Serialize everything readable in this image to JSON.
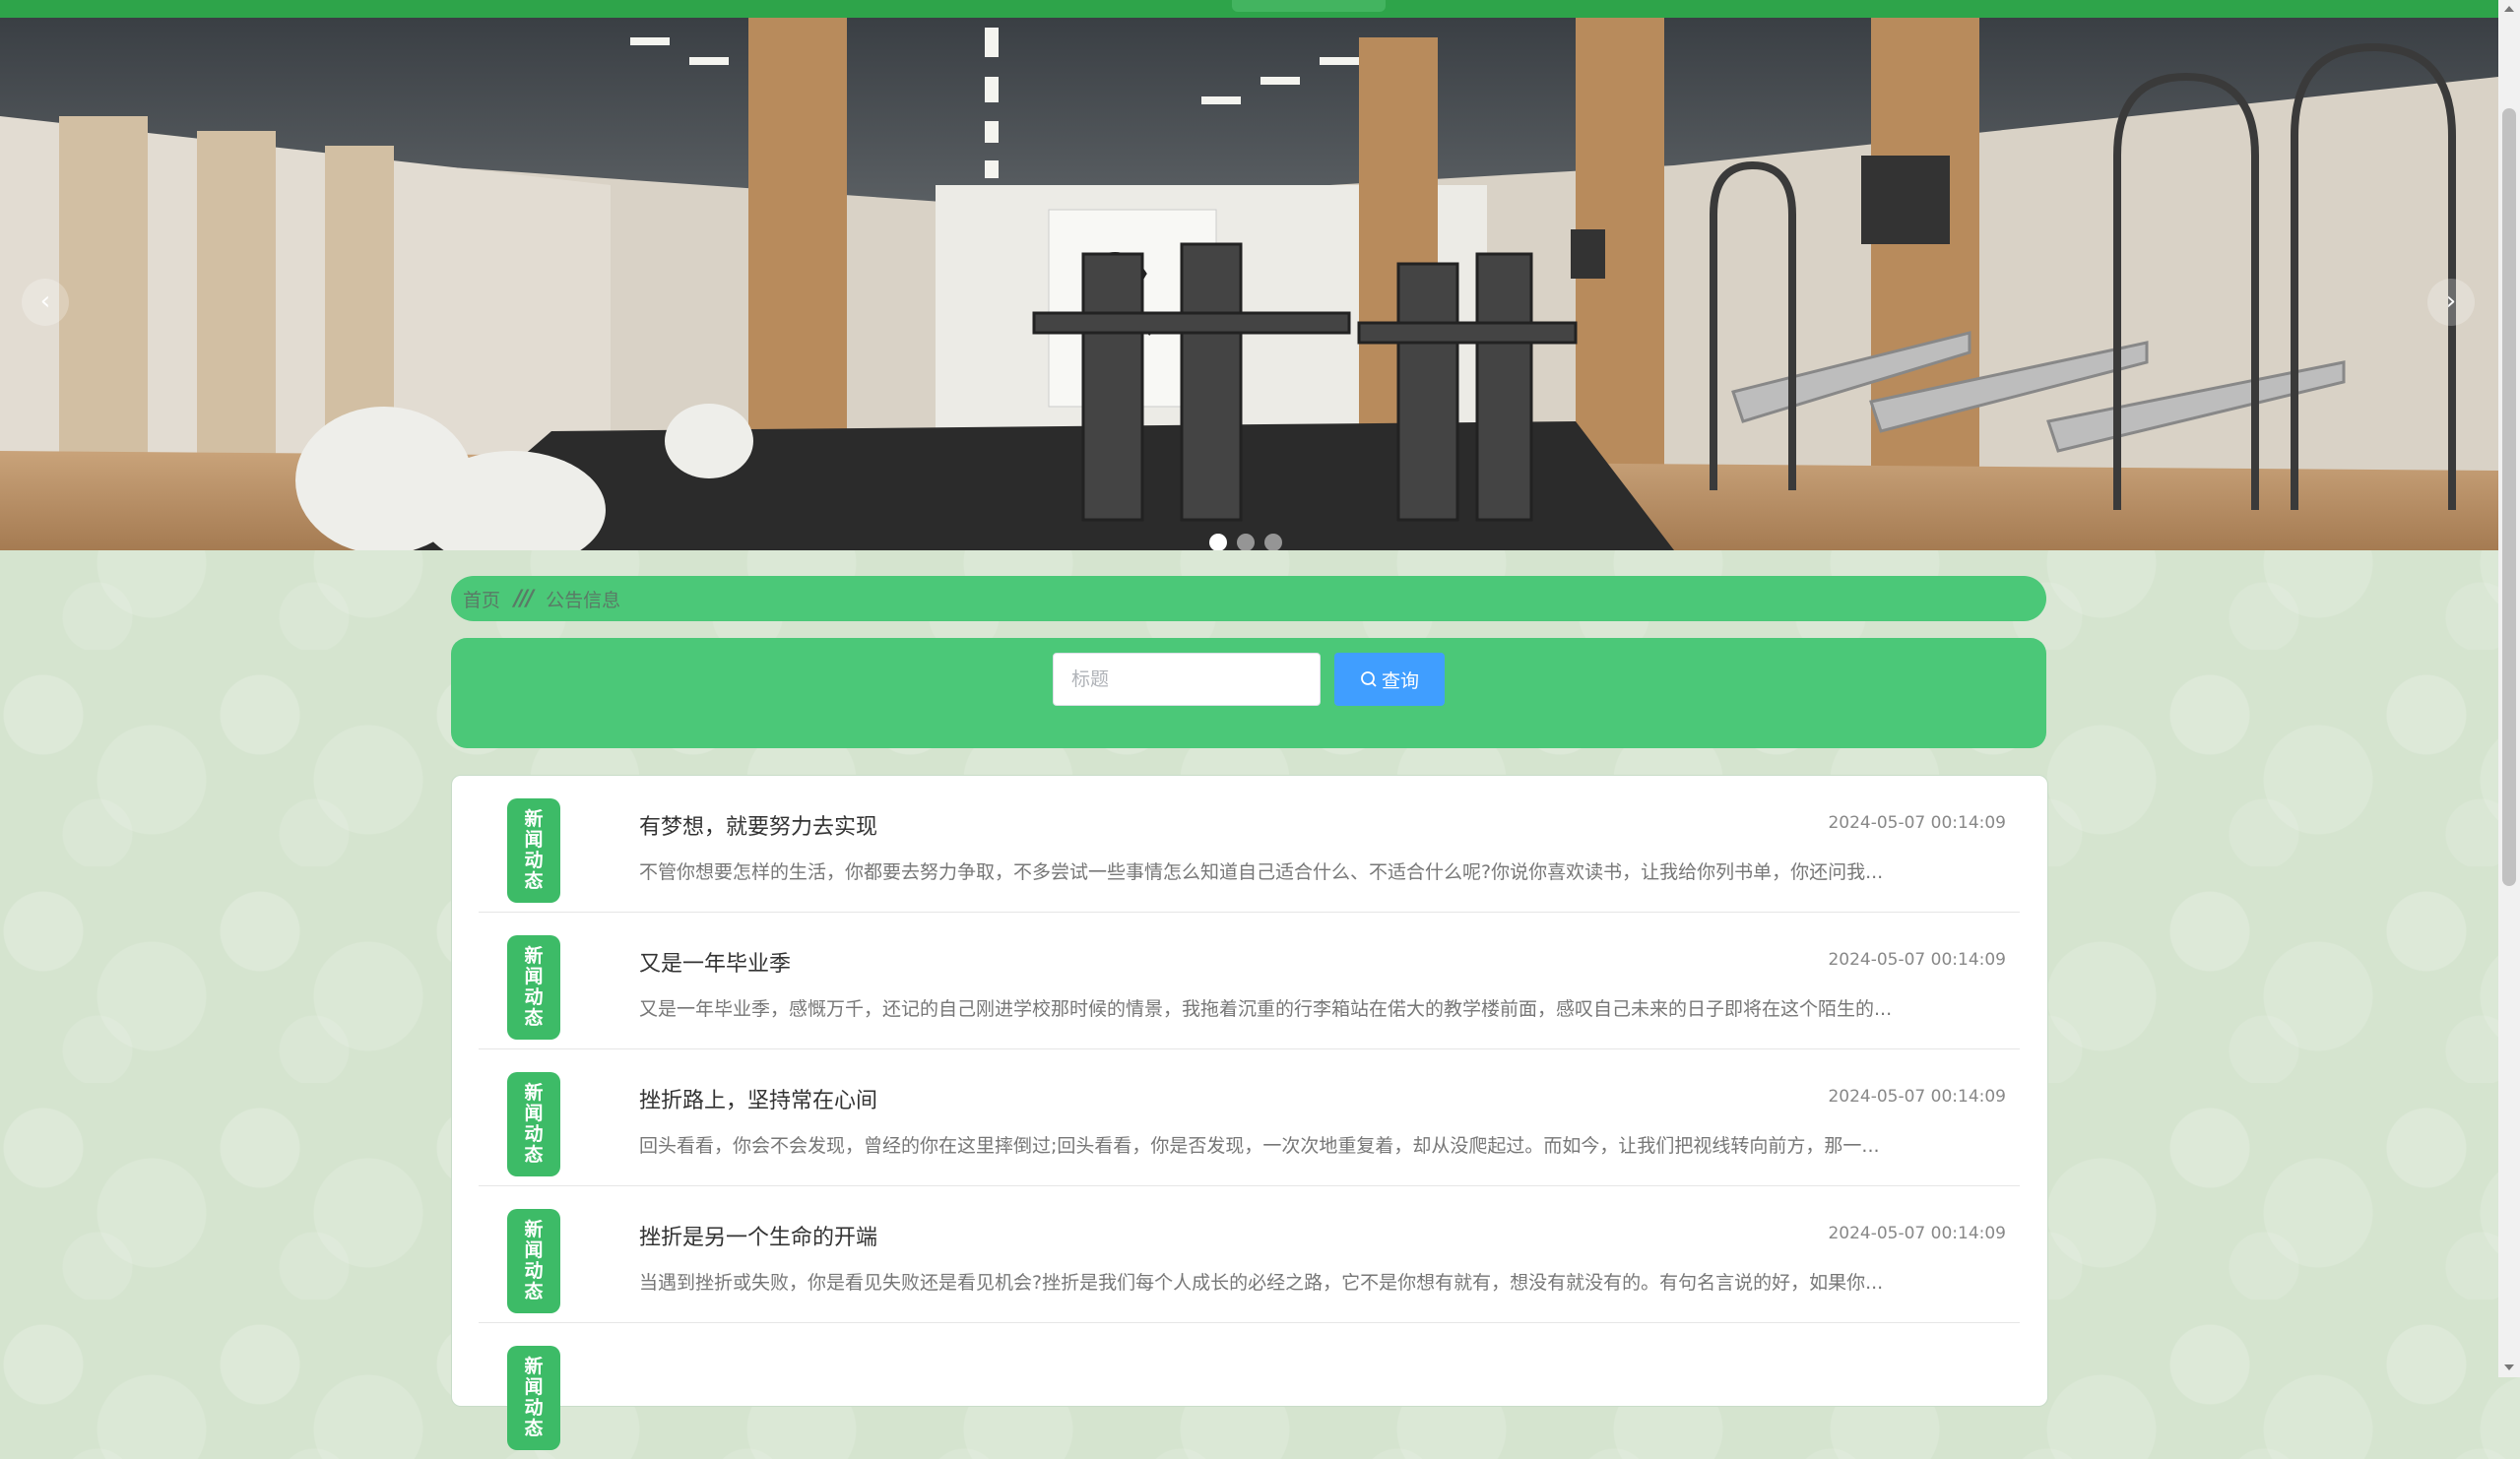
{
  "banner": {
    "prev_arrow": "‹",
    "next_arrow": "›",
    "slide_count": 3,
    "active_slide": 1
  },
  "breadcrumb": {
    "home": "首页",
    "separator": "///",
    "current": "公告信息"
  },
  "search": {
    "placeholder": "标题",
    "button_icon": "search-icon",
    "button_label": "查询"
  },
  "colors": {
    "accent_green": "#4bc878",
    "badge_green": "#3dbb67",
    "button_blue": "#409eff"
  },
  "news": [
    {
      "badge": [
        "新",
        "闻",
        "动",
        "态"
      ],
      "title": "有梦想，就要努力去实现",
      "date": "2024-05-07 00:14:09",
      "desc": "不管你想要怎样的生活，你都要去努力争取，不多尝试一些事情怎么知道自己适合什么、不适合什么呢?你说你喜欢读书，让我给你列书单，你还问我..."
    },
    {
      "badge": [
        "新",
        "闻",
        "动",
        "态"
      ],
      "title": "又是一年毕业季",
      "date": "2024-05-07 00:14:09",
      "desc": "又是一年毕业季，感慨万千，还记的自己刚进学校那时候的情景，我拖着沉重的行李箱站在偌大的教学楼前面，感叹自己未来的日子即将在这个陌生的..."
    },
    {
      "badge": [
        "新",
        "闻",
        "动",
        "态"
      ],
      "title": "挫折路上，坚持常在心间",
      "date": "2024-05-07 00:14:09",
      "desc": "回头看看，你会不会发现，曾经的你在这里摔倒过;回头看看，你是否发现，一次次地重复着，却从没爬起过。而如今，让我们把视线转向前方，那一..."
    },
    {
      "badge": [
        "新",
        "闻",
        "动",
        "态"
      ],
      "title": "挫折是另一个生命的开端",
      "date": "2024-05-07 00:14:09",
      "desc": "当遇到挫折或失败，你是看见失败还是看见机会?挫折是我们每个人成长的必经之路，它不是你想有就有，想没有就没有的。有句名言说的好，如果你..."
    },
    {
      "badge": [
        "新",
        "闻",
        "动",
        "态"
      ],
      "title": "",
      "date": "",
      "desc": ""
    }
  ]
}
